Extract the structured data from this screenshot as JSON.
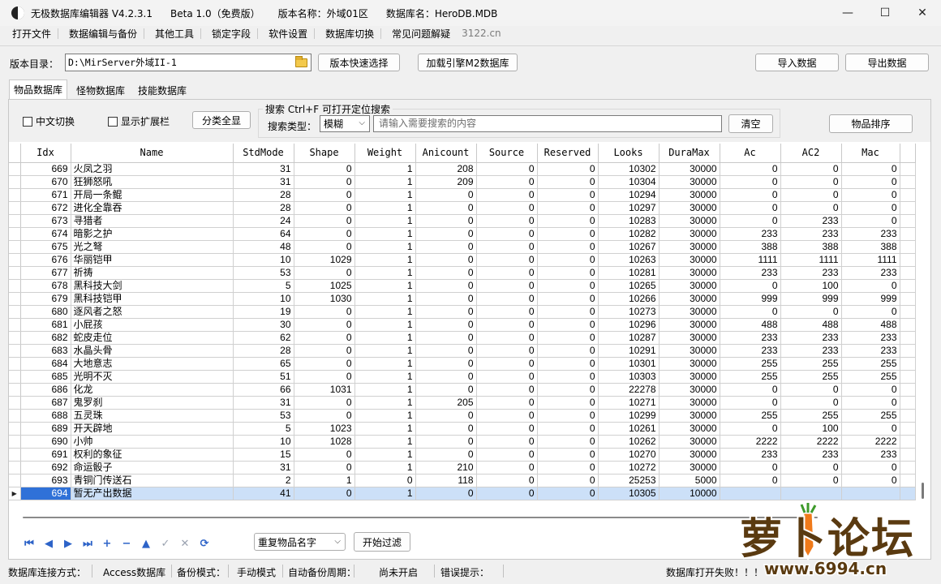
{
  "titlebar": {
    "app": "无极数据库编辑器 V4.2.3.1",
    "edition": "Beta 1.0（免费版）",
    "version_name": "版本名称：外域01区",
    "db_name": "数据库名：HeroDB.MDB",
    "minimize": "—",
    "maximize": "☐",
    "close": "✕"
  },
  "menu": {
    "items": [
      "打开文件",
      "数据编辑与备份",
      "其他工具",
      "锁定字段",
      "软件设置",
      "数据库切换",
      "常见问题解疑"
    ],
    "link": "3122.cn"
  },
  "toolbar": {
    "dir_label": "版本目录：",
    "dir_value": "D:\\MirServer外域II-1",
    "quick_select": "版本快速选择",
    "load_engine": "加载引擎M2数据库",
    "import": "导入数据",
    "export": "导出数据"
  },
  "tabs": [
    "物品数据库",
    "怪物数据库",
    "技能数据库"
  ],
  "filters": {
    "chinese_switch": "中文切换",
    "show_ext": "显示扩展栏",
    "category_all": "分类全显",
    "search_title": "搜索   Ctrl+F 可打开定位搜索",
    "search_type_label": "搜索类型：",
    "search_type_value": "模糊",
    "search_placeholder": "请输入需要搜索的内容",
    "clear": "清空",
    "sort": "物品排序"
  },
  "table": {
    "columns": [
      "Idx",
      "Name",
      "StdMode",
      "Shape",
      "Weight",
      "Anicount",
      "Source",
      "Reserved",
      "Looks",
      "DuraMax",
      "Ac",
      "AC2",
      "Mac"
    ],
    "rows": [
      [
        "669",
        "火凤之羽",
        "31",
        "0",
        "1",
        "208",
        "0",
        "0",
        "10302",
        "30000",
        "0",
        "0",
        "0"
      ],
      [
        "670",
        "狂狮怒吼",
        "31",
        "0",
        "1",
        "209",
        "0",
        "0",
        "10304",
        "30000",
        "0",
        "0",
        "0"
      ],
      [
        "671",
        "开局一条鲲",
        "28",
        "0",
        "1",
        "0",
        "0",
        "0",
        "10294",
        "30000",
        "0",
        "0",
        "0"
      ],
      [
        "672",
        "进化全靠吞",
        "28",
        "0",
        "1",
        "0",
        "0",
        "0",
        "10297",
        "30000",
        "0",
        "0",
        "0"
      ],
      [
        "673",
        "寻猎者",
        "24",
        "0",
        "1",
        "0",
        "0",
        "0",
        "10283",
        "30000",
        "0",
        "233",
        "0"
      ],
      [
        "674",
        "暗影之护",
        "64",
        "0",
        "1",
        "0",
        "0",
        "0",
        "10282",
        "30000",
        "233",
        "233",
        "233"
      ],
      [
        "675",
        "光之弩",
        "48",
        "0",
        "1",
        "0",
        "0",
        "0",
        "10267",
        "30000",
        "388",
        "388",
        "388"
      ],
      [
        "676",
        "华丽铠甲",
        "10",
        "1029",
        "1",
        "0",
        "0",
        "0",
        "10263",
        "30000",
        "1111",
        "1111",
        "1111"
      ],
      [
        "677",
        "祈祷",
        "53",
        "0",
        "1",
        "0",
        "0",
        "0",
        "10281",
        "30000",
        "233",
        "233",
        "233"
      ],
      [
        "678",
        "黑科技大剑",
        "5",
        "1025",
        "1",
        "0",
        "0",
        "0",
        "10265",
        "30000",
        "0",
        "100",
        "0"
      ],
      [
        "679",
        "黑科技铠甲",
        "10",
        "1030",
        "1",
        "0",
        "0",
        "0",
        "10266",
        "30000",
        "999",
        "999",
        "999"
      ],
      [
        "680",
        "逐风者之怒",
        "19",
        "0",
        "1",
        "0",
        "0",
        "0",
        "10273",
        "30000",
        "0",
        "0",
        "0"
      ],
      [
        "681",
        "小屁孩",
        "30",
        "0",
        "1",
        "0",
        "0",
        "0",
        "10296",
        "30000",
        "488",
        "488",
        "488"
      ],
      [
        "682",
        "蛇皮走位",
        "62",
        "0",
        "1",
        "0",
        "0",
        "0",
        "10287",
        "30000",
        "233",
        "233",
        "233"
      ],
      [
        "683",
        "水晶头骨",
        "28",
        "0",
        "1",
        "0",
        "0",
        "0",
        "10291",
        "30000",
        "233",
        "233",
        "233"
      ],
      [
        "684",
        "大地意志",
        "65",
        "0",
        "1",
        "0",
        "0",
        "0",
        "10301",
        "30000",
        "255",
        "255",
        "255"
      ],
      [
        "685",
        "光明不灭",
        "51",
        "0",
        "1",
        "0",
        "0",
        "0",
        "10303",
        "30000",
        "255",
        "255",
        "255"
      ],
      [
        "686",
        "化龙",
        "66",
        "1031",
        "1",
        "0",
        "0",
        "0",
        "22278",
        "30000",
        "0",
        "0",
        "0"
      ],
      [
        "687",
        "鬼罗刹",
        "31",
        "0",
        "1",
        "205",
        "0",
        "0",
        "10271",
        "30000",
        "0",
        "0",
        "0"
      ],
      [
        "688",
        "五灵珠",
        "53",
        "0",
        "1",
        "0",
        "0",
        "0",
        "10299",
        "30000",
        "255",
        "255",
        "255"
      ],
      [
        "689",
        "开天辟地",
        "5",
        "1023",
        "1",
        "0",
        "0",
        "0",
        "10261",
        "30000",
        "0",
        "100",
        "0"
      ],
      [
        "690",
        "小帅",
        "10",
        "1028",
        "1",
        "0",
        "0",
        "0",
        "10262",
        "30000",
        "2222",
        "2222",
        "2222"
      ],
      [
        "691",
        "权利的象征",
        "15",
        "0",
        "1",
        "0",
        "0",
        "0",
        "10270",
        "30000",
        "233",
        "233",
        "233"
      ],
      [
        "692",
        "命运骰子",
        "31",
        "0",
        "1",
        "210",
        "0",
        "0",
        "10272",
        "30000",
        "0",
        "0",
        "0"
      ],
      [
        "693",
        "青铜门传送石",
        "2",
        "1",
        "0",
        "118",
        "0",
        "0",
        "25253",
        "5000",
        "0",
        "0",
        "0"
      ],
      [
        "694",
        "暂无产出数据",
        "41",
        "0",
        "1",
        "0",
        "0",
        "0",
        "10305",
        "10000",
        "",
        "",
        ""
      ]
    ],
    "selected_row": 25
  },
  "navigator": {
    "buttons": [
      {
        "name": "first-icon",
        "glyph": "⏮"
      },
      {
        "name": "prior-icon",
        "glyph": "◀"
      },
      {
        "name": "next-icon",
        "glyph": "▶"
      },
      {
        "name": "last-icon",
        "glyph": "⏭"
      },
      {
        "name": "insert-icon",
        "glyph": "+"
      },
      {
        "name": "delete-icon",
        "glyph": "−"
      },
      {
        "name": "edit-icon",
        "glyph": "▲"
      },
      {
        "name": "post-icon",
        "glyph": "✓"
      },
      {
        "name": "cancel-icon",
        "glyph": "✕"
      },
      {
        "name": "refresh-icon",
        "glyph": "⟳"
      }
    ],
    "dup_select": "重复物品名字",
    "filter_btn": "开始过滤"
  },
  "status": {
    "conn_label": "数据库连接方式：",
    "conn_value": "Access数据库",
    "backup_label": "备份模式：",
    "backup_value": "手动模式",
    "auto_label": "自动备份周期：",
    "auto_value": "尚未开启",
    "err_label": "错误提示：",
    "err_value": "数据库打开失败！！！"
  },
  "watermark": {
    "text": "萝卜论坛",
    "url": "www.6994.cn"
  },
  "colors": {
    "selected_row": "#cce0f8",
    "selected_cell": "#2f71d8",
    "nav_icon": "#2d63c8",
    "logo_text": "#5a3a10",
    "logo_outline": "#ffffff",
    "logo_accent": "#f07a1a"
  }
}
